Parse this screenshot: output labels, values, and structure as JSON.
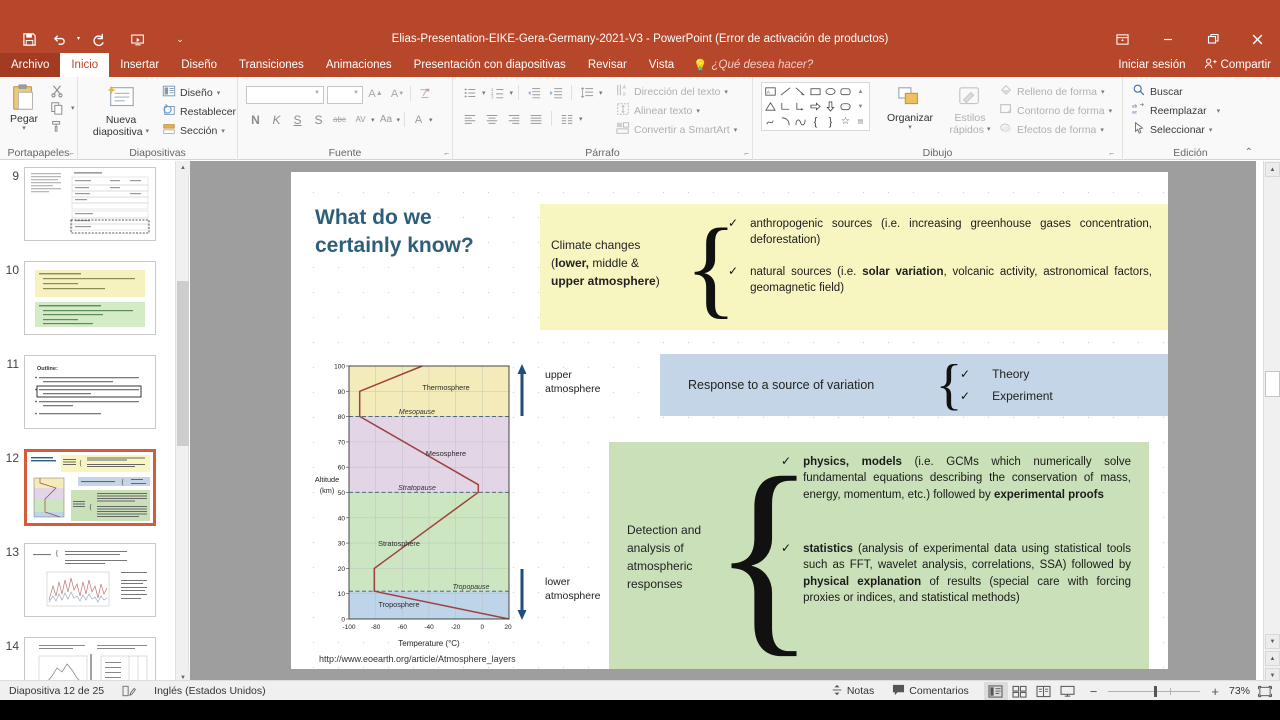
{
  "window": {
    "title": "Elias-Presentation-EIKE-Gera-Germany-2021-V3 - PowerPoint (Error de activación de productos)",
    "qat": [
      {
        "name": "save-icon",
        "glyph": "save"
      },
      {
        "name": "undo-icon",
        "glyph": "undo"
      },
      {
        "name": "redo-icon",
        "glyph": "redo"
      },
      {
        "name": "start-slideshow-icon",
        "glyph": "slideshow"
      },
      {
        "name": "customize-qat-icon",
        "glyph": "caret"
      }
    ],
    "controls": {
      "ribbon_display": "⊡",
      "minimize": "—",
      "restore": "❐",
      "close": "✕"
    }
  },
  "ribbon_tabs": {
    "file": "Archivo",
    "items": [
      {
        "label": "Inicio",
        "active": true
      },
      {
        "label": "Insertar",
        "active": false
      },
      {
        "label": "Diseño",
        "active": false
      },
      {
        "label": "Transiciones",
        "active": false
      },
      {
        "label": "Animaciones",
        "active": false
      },
      {
        "label": "Presentación con diapositivas",
        "active": false
      },
      {
        "label": "Revisar",
        "active": false
      },
      {
        "label": "Vista",
        "active": false
      }
    ],
    "tell_me": "¿Qué desea hacer?",
    "sign_in": "Iniciar sesión",
    "share": "Compartir"
  },
  "ribbon": {
    "groups": [
      {
        "name": "clipboard",
        "label": "Portapapeles"
      },
      {
        "name": "slides",
        "label": "Diapositivas"
      },
      {
        "name": "font",
        "label": "Fuente"
      },
      {
        "name": "paragraph",
        "label": "Párrafo"
      },
      {
        "name": "drawing",
        "label": "Dibujo"
      },
      {
        "name": "editing",
        "label": "Edición"
      }
    ],
    "clipboard": {
      "paste": "Pegar",
      "cut": "Cortar",
      "copy": "Copiar",
      "format_painter": "Copiar formato"
    },
    "slides": {
      "new_slide": "Nueva\ndiapositiva",
      "new_slide_line1": "Nueva",
      "new_slide_line2": "diapositiva",
      "layout": "Diseño",
      "reset": "Restablecer",
      "section": "Sección"
    },
    "font": {
      "font_name_value": "",
      "font_name_placeholder": "",
      "font_size_value": "",
      "grow": "A",
      "shrink": "A",
      "clear_formatting": "Borrar todo el formato",
      "bold": "N",
      "italic": "K",
      "underline": "S",
      "shadow": "S",
      "strikethrough": "abc",
      "char_spacing": "AV",
      "change_case": "Aa",
      "font_color": "A"
    },
    "paragraph": {
      "text_direction": "Dirección del texto",
      "align_text": "Alinear texto",
      "convert_smartart": "Convertir a SmartArt"
    },
    "drawing": {
      "arrange": "Organizar",
      "quick_styles_line1": "Estilos",
      "quick_styles_line2": "rápidos",
      "shape_fill": "Relleno de forma",
      "shape_outline": "Contorno de forma",
      "shape_effects": "Efectos de forma"
    },
    "editing": {
      "find": "Buscar",
      "replace": "Reemplazar",
      "select": "Seleccionar"
    }
  },
  "thumbnails": [
    {
      "number": "9",
      "selected": false
    },
    {
      "number": "10",
      "selected": false
    },
    {
      "number": "11",
      "selected": false
    },
    {
      "number": "12",
      "selected": true
    },
    {
      "number": "13",
      "selected": false
    },
    {
      "number": "14",
      "selected": false
    }
  ],
  "slide": {
    "title_line1": "What do we",
    "title_line2": "certainly know?",
    "yellow": {
      "lead_line1": "Climate changes",
      "lead_line2_a": "(",
      "lead_line2_b": "lower,",
      "lead_line2_c": " middle &",
      "lead_line3_a": "upper atmosphere",
      "lead_line3_b": ")",
      "bullets": [
        {
          "check": "✓",
          "text_a": "anthropogenic sources (i.e. increasing greenhouse gases concentration, deforestation)"
        },
        {
          "check": "✓",
          "pre": "natural sources (i.e. ",
          "bold": "solar variation",
          "post": ", volcanic activity, astronomical factors, geomagnetic field)"
        }
      ]
    },
    "blue": {
      "lead": "Response to a source of variation",
      "items": [
        {
          "check": "✓",
          "label": "Theory"
        },
        {
          "check": "✓",
          "label": "Experiment"
        }
      ]
    },
    "green": {
      "lead_line1": "Detection and",
      "lead_line2": "analysis of",
      "lead_line3": "atmospheric",
      "lead_line4": "responses",
      "bullets": [
        {
          "check": "✓",
          "bold1": "physics, models",
          "mid": " (i.e. GCMs which numerically solve fundamental equations describing the conservation of mass, energy, momentum, etc.) followed by ",
          "bold2": "experimental proofs",
          "tail": ""
        },
        {
          "check": "✓",
          "bold1": "statistics",
          "mid": " (analysis of experimental data using statistical tools such as FFT, wavelet analysis, correlations, SSA) followed by ",
          "bold2": "physical explanation",
          "tail": " of results (special care with forcing proxies or indices, and statistical methods)"
        }
      ]
    },
    "citation": "http://www.eoearth.org/article/Atmosphere_layers",
    "annotations": {
      "upper_line1": "upper",
      "upper_line2": "atmosphere",
      "lower_line1": "lower",
      "lower_line2": "atmosphere"
    }
  },
  "chart_data": {
    "type": "line",
    "title": "",
    "xlabel": "Temperature (°C)",
    "ylabel_line1": "Altitude",
    "ylabel_line2": "(km)",
    "xlim": [
      -100,
      20
    ],
    "ylim": [
      0,
      100
    ],
    "xticks": [
      -100,
      -80,
      -60,
      -40,
      -20,
      0,
      20
    ],
    "xtick_labels": [
      "-100",
      "-80",
      "-60",
      "-20",
      "0",
      "20",
      "-40"
    ],
    "xticks_labeled": [
      "-100",
      "-80",
      "-60",
      "-40",
      "-20",
      "0",
      "20"
    ],
    "yticks": [
      0,
      10,
      20,
      30,
      40,
      50,
      60,
      70,
      80,
      90,
      100
    ],
    "ytick_labels": [
      "0",
      "10",
      "20",
      "30",
      "40",
      "50",
      "60",
      "70",
      "80",
      "90",
      "100"
    ],
    "grid": true,
    "series": [
      {
        "name": "Standard atmosphere temperature profile",
        "color": "#a0403f",
        "points": [
          {
            "t": 15,
            "z": 0
          },
          {
            "t": -56,
            "z": 11
          },
          {
            "t": -56,
            "z": 20
          },
          {
            "t": -3,
            "z": 50
          },
          {
            "t": -3,
            "z": 53
          },
          {
            "t": -92,
            "z": 80
          },
          {
            "t": -92,
            "z": 90
          },
          {
            "t": -45,
            "z": 100
          }
        ]
      }
    ],
    "layers": [
      {
        "name": "Troposphere",
        "z_from": 0,
        "z_to": 11,
        "color": "#bed4e8",
        "label_z": 4
      },
      {
        "name": "Stratosphere",
        "z_from": 11,
        "z_to": 50,
        "color": "#cbe6c0",
        "label_z": 30
      },
      {
        "name": "Mesosphere",
        "z_from": 50,
        "z_to": 80,
        "color": "#e1d5e6",
        "label_z": 65
      },
      {
        "name": "Thermosphere",
        "z_from": 80,
        "z_to": 100,
        "color": "#f3ecba",
        "label_z": 91
      }
    ],
    "boundaries": [
      {
        "name": "Tropopause",
        "z": 11
      },
      {
        "name": "Stratopause",
        "z": 50
      },
      {
        "name": "Mesopause",
        "z": 80
      }
    ]
  },
  "status_bar": {
    "slide_counter": "Diapositiva 12 de 25",
    "language": "Inglés (Estados Unidos)",
    "notes": "Notas",
    "comments": "Comentarios",
    "zoom_level": "73%",
    "zoom_out": "−",
    "zoom_in": "+",
    "views": [
      {
        "name": "normal-view",
        "active": true
      },
      {
        "name": "slide-sorter-view",
        "active": false
      },
      {
        "name": "reading-view",
        "active": false
      },
      {
        "name": "slideshow-view",
        "active": false
      }
    ]
  },
  "colors": {
    "accent": "#b7472a",
    "title_text": "#2e5f7a",
    "yellow_box": "#f8f6c0",
    "blue_box": "#c3d5e6",
    "green_box": "#c9e0b8",
    "selection": "#d25c3c"
  }
}
